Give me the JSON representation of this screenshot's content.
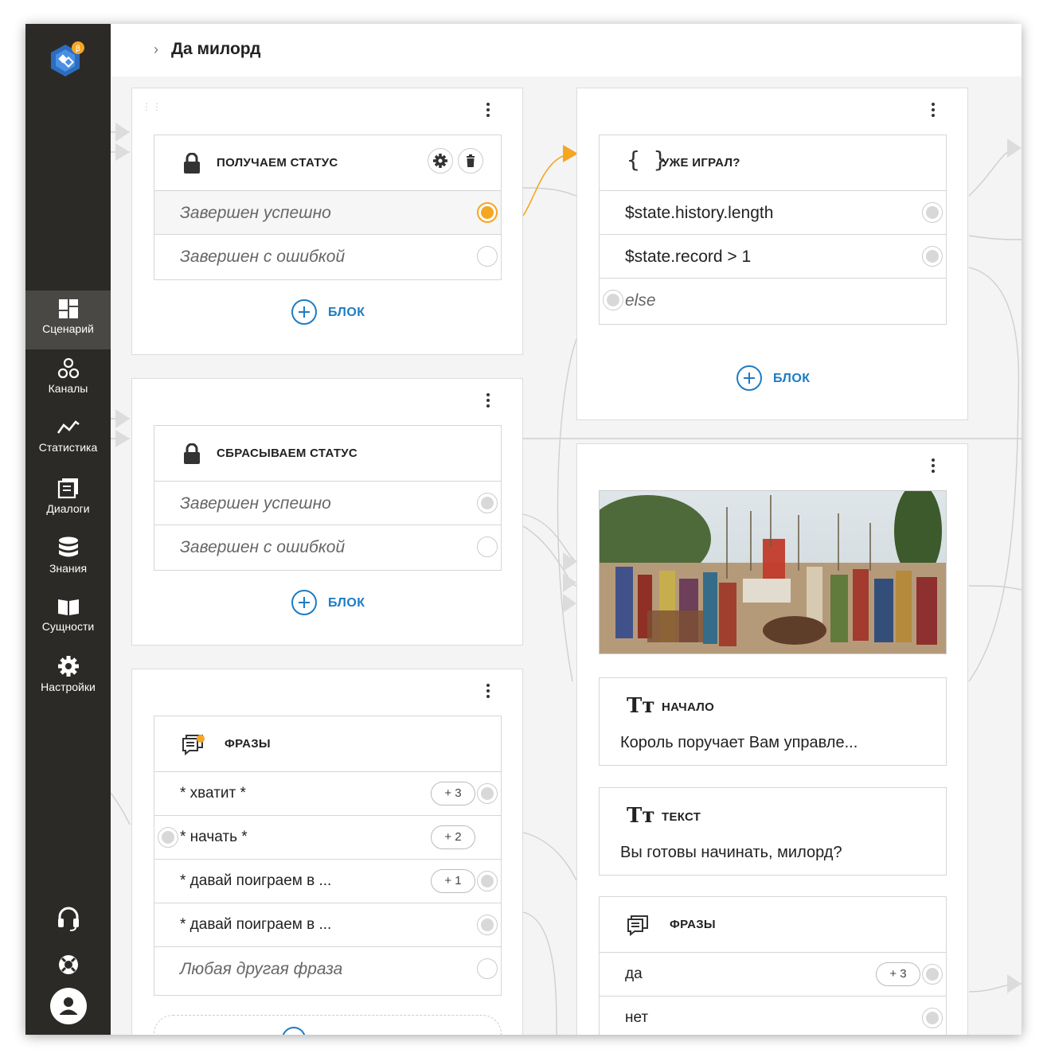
{
  "app": {
    "title": "Да милорд"
  },
  "sidebar": {
    "items": [
      {
        "label": "Сценарий",
        "icon": "dashboard-icon",
        "active": true
      },
      {
        "label": "Каналы",
        "icon": "channels-icon"
      },
      {
        "label": "Статистика",
        "icon": "stats-icon"
      },
      {
        "label": "Диалоги",
        "icon": "dialogs-icon"
      },
      {
        "label": "Знания",
        "icon": "database-icon"
      },
      {
        "label": "Сущности",
        "icon": "book-icon"
      },
      {
        "label": "Настройки",
        "icon": "gear-icon"
      }
    ],
    "bottom": [
      "headset-icon",
      "lifebuoy-icon",
      "user-avatar-icon"
    ]
  },
  "screens": {
    "status_get": {
      "title": "ПОЛУЧАЕМ СТАТУС",
      "rows": [
        "Завершен успешно",
        "Завершен с ошибкой"
      ],
      "add_label": "БЛОК"
    },
    "status_reset": {
      "title": "СБРАСЫВАЕМ СТАТУС",
      "rows": [
        "Завершен успешно",
        "Завершен с ошибкой"
      ],
      "add_label": "БЛОК"
    },
    "phrases_left": {
      "title": "ФРАЗЫ",
      "rows": [
        "* хватит *",
        "* начать *",
        "* давай поиграем в ...",
        "* давай поиграем в ...",
        "Любая другая фраза"
      ],
      "badges": [
        "+ 3",
        "+ 2",
        "+ 1"
      ]
    },
    "played": {
      "title": "УЖЕ ИГРАЛ?",
      "icon_text": "{ }",
      "rows": [
        "$state.history.length",
        "$state.record > 1",
        "else"
      ],
      "add_label": "БЛОК"
    },
    "start": {
      "text_icon": "Tт",
      "start_title": "НАЧАЛО",
      "start_body": "Король поручает Вам управле...",
      "text_title": "ТЕКСТ",
      "text_body": "Вы готовы начинать, милорд?",
      "phrases_title": "ФРАЗЫ",
      "phrases": [
        "да",
        "нет"
      ],
      "badge": "+ 3"
    }
  },
  "colors": {
    "accent": "#1c7cc4",
    "selected": "#f5a623",
    "sidebar": "#2c2a27"
  }
}
